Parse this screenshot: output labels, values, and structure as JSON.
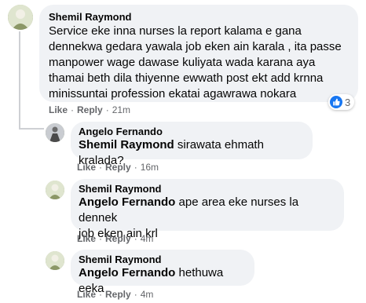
{
  "comments": [
    {
      "author": "Shemil Raymond",
      "text": "Service eke inna nurses la report kalama e gana dennekwa gedara yawala job eken ain karala , ita passe manpower wage dawase kuliyata wada karana aya thamai beth dila thiyenne ewwath post ekt add krnna minissuntai profession ekatai agawrawa nokara",
      "like": "Like",
      "reply": "Reply",
      "time": "21m",
      "reaction_count": "3",
      "reaction_icon": "like-icon"
    },
    {
      "author": "Angelo Fernando",
      "mention": "Shemil Raymond",
      "text": " sirawata ehmath kralada?",
      "like": "Like",
      "reply": "Reply",
      "time": "16m"
    },
    {
      "author": "Shemil Raymond",
      "mention": "Angelo Fernando",
      "text_line1": " ape area eke nurses la dennek",
      "text_line2": "job eken ain krl",
      "like": "Like",
      "reply": "Reply",
      "time": "4m"
    },
    {
      "author": "Shemil Raymond",
      "mention": "Angelo Fernando",
      "text": " hethuwa eeka",
      "like": "Like",
      "reply": "Reply",
      "time": "4m"
    }
  ],
  "separator": "·",
  "colors": {
    "bubble": "#f0f2f5",
    "meta": "#65676b",
    "like_blue": "#1877f2"
  }
}
